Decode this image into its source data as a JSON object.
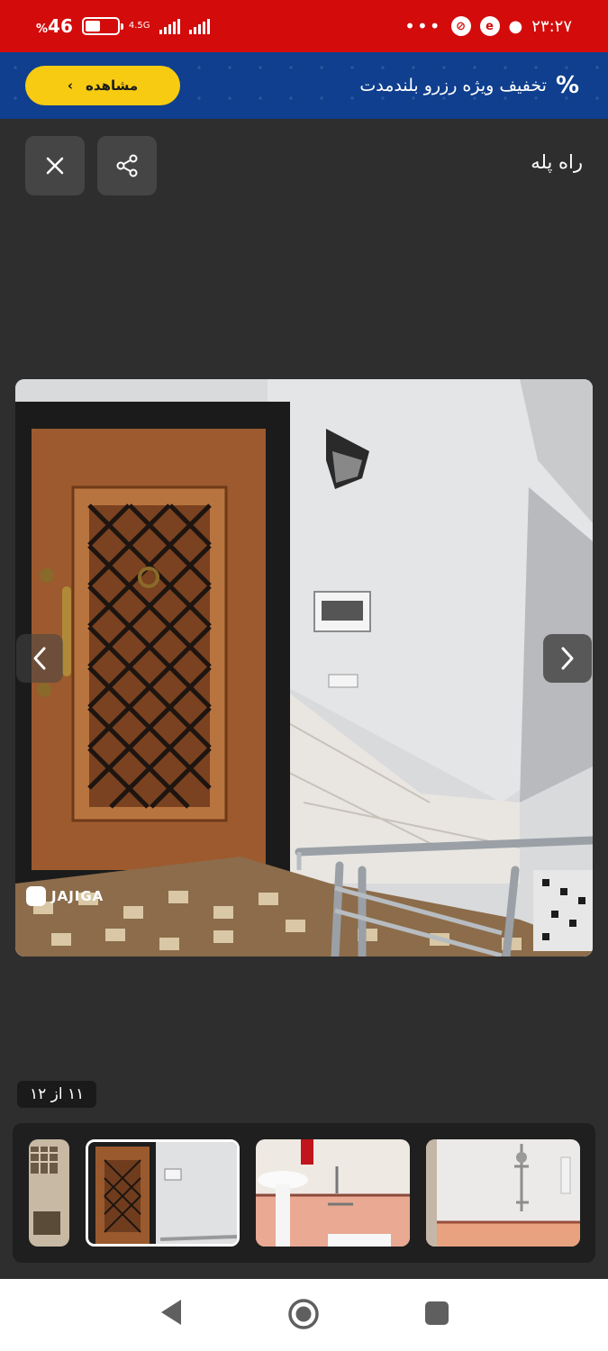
{
  "status_bar": {
    "battery_percent": "46",
    "battery_sign": "%",
    "battery_level": 0.46,
    "network_type": "4.5G",
    "time": "۲۳:۲۷",
    "more_dots": "•••"
  },
  "promo": {
    "view_label": "مشاهده",
    "view_chevron": "›",
    "percent_icon": "%",
    "text": "تخفیف ویژه رزرو بلندمدت",
    "background": "#0f3f8e",
    "button_color": "#f7cb12"
  },
  "header": {
    "title": "راه پله",
    "close_icon": "close-icon",
    "share_icon": "share-icon"
  },
  "gallery": {
    "watermark": "JAJIGA",
    "counter": "۱۱ از ۱۲",
    "thumbnails": [
      {
        "name": "building-exterior"
      },
      {
        "name": "staircase-door"
      },
      {
        "name": "bathroom-sink"
      },
      {
        "name": "shower"
      }
    ]
  },
  "colors": {
    "status_bar": "#d30b0b",
    "background": "#2e2e2e",
    "thumb_strip": "#1f1f1f"
  }
}
